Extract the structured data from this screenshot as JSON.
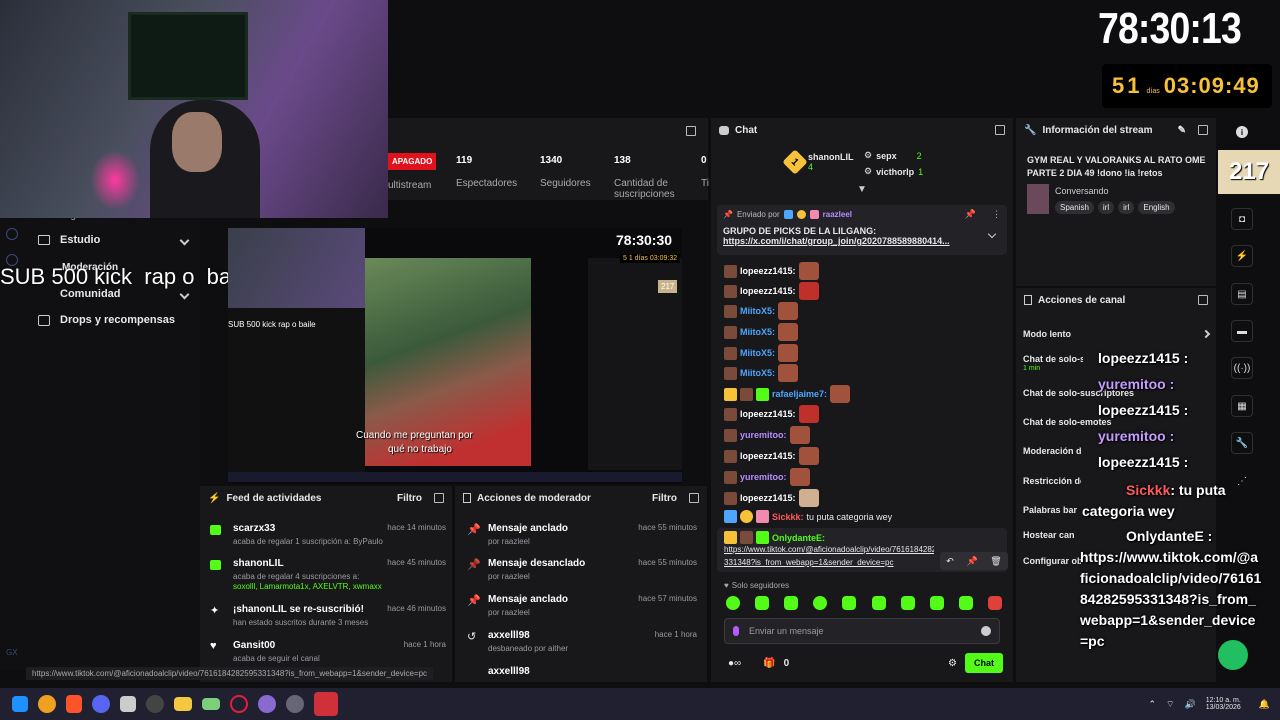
{
  "timer": {
    "main": "78:30:13",
    "days_num": "51",
    "days_label": "días",
    "countdown": "03:09:49"
  },
  "badge217": "217",
  "stats": {
    "status": "APAGADO",
    "multistream": "ultistream",
    "items": [
      {
        "value": "119",
        "label": "Espectadores"
      },
      {
        "value": "1340",
        "label": "Seguidores"
      },
      {
        "value": "138",
        "label": "Cantidad de suscripciones"
      },
      {
        "value": "0",
        "label": "Ti"
      }
    ]
  },
  "sidebar": {
    "items": [
      "Estudio",
      "Moderación",
      "Comunidad",
      "Drops y recompensas"
    ],
    "partial": "Ingresos"
  },
  "overlay_sub": "SUB 500 kick  rap o  baile",
  "video": {
    "caption1": "Cuando me preguntan por",
    "caption2": "qué no trabajo",
    "sub_small": "SUB 500 kick  rap o  baile",
    "timer": "78:30:30",
    "countdown": "5 1 días 03:09:32",
    "badge": "217"
  },
  "chat": {
    "title": "Chat",
    "leaders": [
      {
        "rank": "1",
        "name": "shanonLIL",
        "count": "4"
      },
      {
        "name": "sepx",
        "count": "2"
      },
      {
        "name": "victhorlp",
        "count": "1"
      }
    ],
    "pinned": {
      "label": "Enviado por",
      "user": "raazleel",
      "text": "GRUPO DE PICKS DE LA LILGANG:",
      "link": "https://x.com/i/chat/group_join/g2020788589880414..."
    },
    "messages": [
      {
        "user": "lopeezz1415:",
        "color": "g"
      },
      {
        "user": "lopeezz1415:",
        "color": "g"
      },
      {
        "user": "MiitoX5:",
        "color": "b"
      },
      {
        "user": "MiitoX5:",
        "color": "b"
      },
      {
        "user": "MiitoX5:",
        "color": "b"
      },
      {
        "user": "MiitoX5:",
        "color": "b"
      },
      {
        "user": "rafaeljaime7:",
        "color": "b"
      },
      {
        "user": "lopeezz1415:",
        "color": "g"
      },
      {
        "user": "yuremitoo:",
        "color": "p"
      },
      {
        "user": "lopeezz1415:",
        "color": "g"
      },
      {
        "user": "yuremitoo:",
        "color": "p"
      },
      {
        "user": "lopeezz1415:",
        "color": "g"
      }
    ],
    "sickkk": {
      "user": "Sickkk:",
      "text": "tu puta categoria wey"
    },
    "only": {
      "user": "OnlydanteE:",
      "link1": "https://www.tiktok.com/@aficionadoalclip/video/7616184282595",
      "link2": "331348?is_from_webapp=1&sender_device=pc"
    },
    "followers_only": "Solo seguidores",
    "placeholder": "Enviar un mensaje",
    "count": "0",
    "send": "Chat"
  },
  "info": {
    "title": "Información del stream",
    "stream_title": "GYM REAL Y VALORANKS AL RATO OME PARTE 2 DIA 49 !dono !ia !retos",
    "category": "Conversando",
    "tags": [
      "Spanish",
      "irl",
      "irl",
      "English"
    ]
  },
  "actions": {
    "title": "Acciones de canal",
    "items": [
      "Modo lento",
      "Chat de solo-seguidores",
      "1 min",
      "Chat de solo-suscriptores",
      "Chat de solo-emotes",
      "Moderación del chat con IA",
      "Restricción de edad",
      "Palabras bar",
      "Hostear can",
      "Configurar objetivos"
    ]
  },
  "overlay_chat": [
    {
      "user": "lopeezz1415 :",
      "color": "#fff"
    },
    {
      "user": "yuremitoo :",
      "color": "#c49bff"
    },
    {
      "user": "lopeezz1415 :",
      "color": "#fff"
    },
    {
      "user": "yuremitoo :",
      "color": "#c49bff"
    },
    {
      "user": "lopeezz1415 :",
      "color": "#fff"
    }
  ],
  "overlay_sickkk": {
    "user": "Sickkk",
    "text": ": tu puta categoria wey"
  },
  "overlay_only": {
    "user": "OnlydanteE :",
    "text": "https://www.tiktok.com/@aficionadoalclip/video/7616184282595331348?is_from_webapp=1&sender_device=pc"
  },
  "feed": {
    "title": "Feed de actividades",
    "filter": "Filtro",
    "items": [
      {
        "name": "scarzx33",
        "time": "hace 14 minutos",
        "sub": "acaba de regalar 1 suscripción a: ByPaulo"
      },
      {
        "name": "shanonLIL",
        "time": "hace 45 minutos",
        "sub": "acaba de regalar 4 suscripciones a:",
        "sub2": "soxolll, Lamarmota1x, AXELVTR, xwmaxx"
      },
      {
        "name": "¡shanonLIL se re-suscribió!",
        "time": "hace 46 minutos",
        "sub": "han estado suscritos durante 3 meses"
      },
      {
        "name": "Gansit00",
        "time": "hace 1 hora",
        "sub": "acaba de seguir el canal"
      }
    ]
  },
  "mod": {
    "title": "Acciones de moderador",
    "filter": "Filtro",
    "items": [
      {
        "name": "Mensaje anclado",
        "time": "hace 55 minutos",
        "sub": "por raazleel"
      },
      {
        "name": "Mensaje desanclado",
        "time": "hace 55 minutos",
        "sub": "por raazleel"
      },
      {
        "name": "Mensaje anclado",
        "time": "hace 57 minutos",
        "sub": "por raazleel"
      },
      {
        "name": "axxelll98",
        "time": "hace 1 hora",
        "sub": "desbaneado por aither"
      },
      {
        "name": "axxelll98",
        "time": "",
        "sub": ""
      }
    ]
  },
  "statusbar": "https://www.tiktok.com/@aficionadoalclip/video/7616184282595331348?is_from_webapp=1&sender_device=pc",
  "taskbar": {
    "time": "12:10 a. m.",
    "date": "13/03/2026"
  }
}
